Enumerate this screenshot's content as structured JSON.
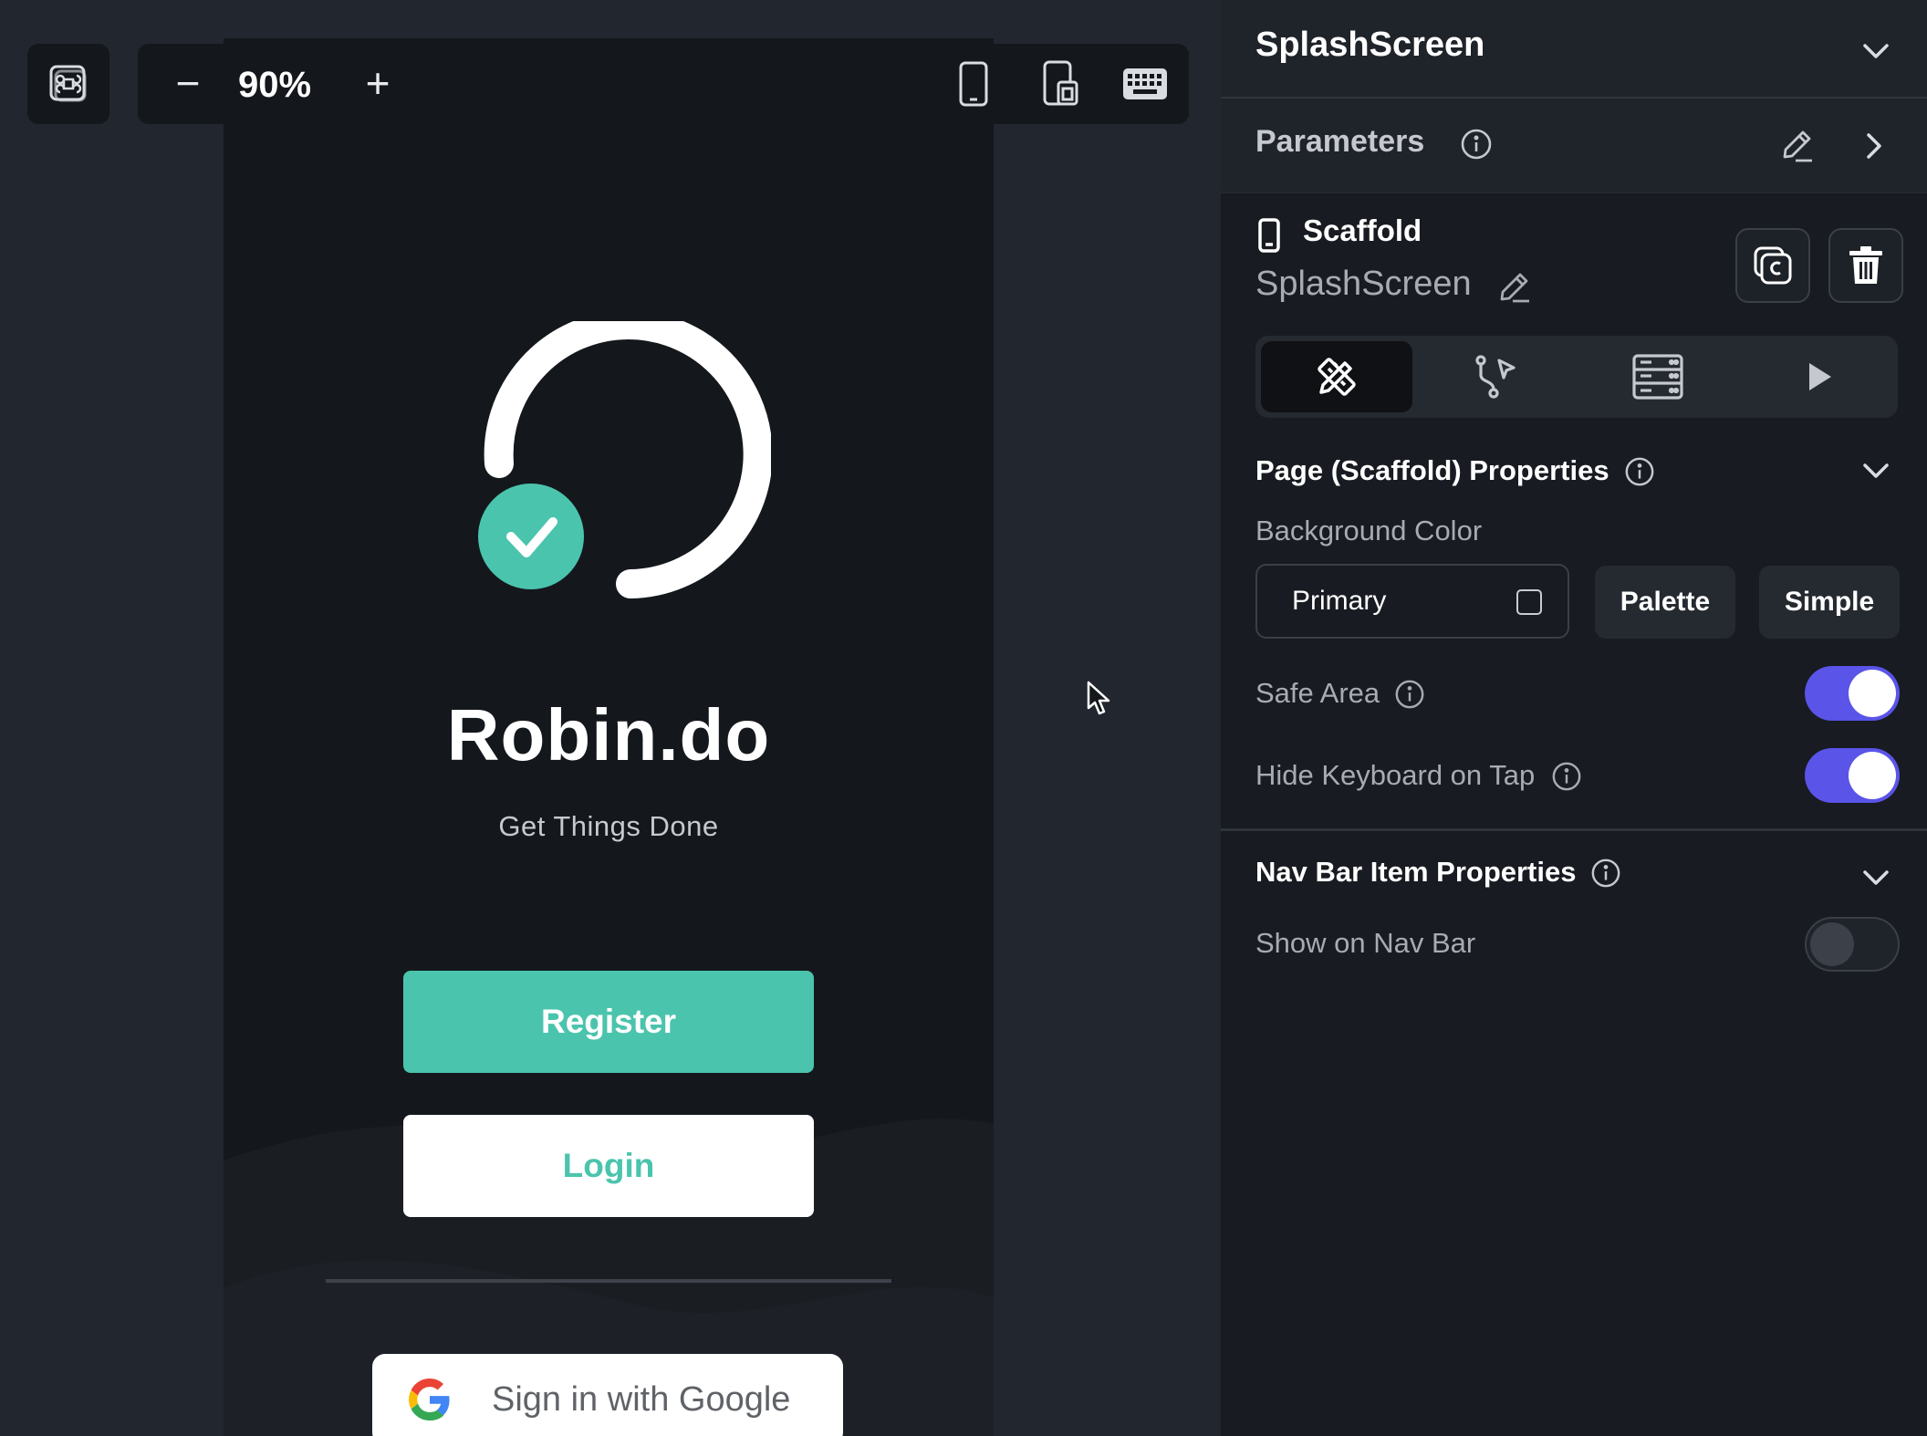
{
  "canvas": {
    "zoom_label": "90%",
    "zoom_minus": "−",
    "zoom_plus": "+"
  },
  "phone": {
    "app_title": "Robin.do",
    "app_subtitle": "Get Things Done",
    "register_label": "Register",
    "login_label": "Login",
    "google_label": "Sign in with Google"
  },
  "panel": {
    "title": "SplashScreen",
    "parameters_label": "Parameters",
    "widget_type": "Scaffold",
    "widget_name": "SplashScreen",
    "page_properties_title": "Page (Scaffold) Properties",
    "background_color_label": "Background Color",
    "background_color_value": "Primary",
    "palette_label": "Palette",
    "simple_label": "Simple",
    "safe_area_label": "Safe Area",
    "safe_area_on": true,
    "hide_keyboard_label": "Hide Keyboard on Tap",
    "hide_keyboard_on": true,
    "nav_bar_title": "Nav Bar Item Properties",
    "show_nav_bar_label": "Show on Nav Bar",
    "show_nav_bar_on": false
  },
  "colors": {
    "accent": "#4bc4ad",
    "toggle_on": "#5a54e8",
    "panel_bg": "#181b21",
    "canvas_bg": "#22262e"
  },
  "icons": [
    "command-icon",
    "phone-icon",
    "tablet-icon",
    "keyboard-icon",
    "info-icon",
    "edit-icon",
    "chevron-right-icon",
    "chevron-down-icon",
    "copy-icon",
    "trash-icon",
    "design-icon",
    "actions-icon",
    "data-icon",
    "run-icon",
    "google-icon",
    "check-icon"
  ]
}
